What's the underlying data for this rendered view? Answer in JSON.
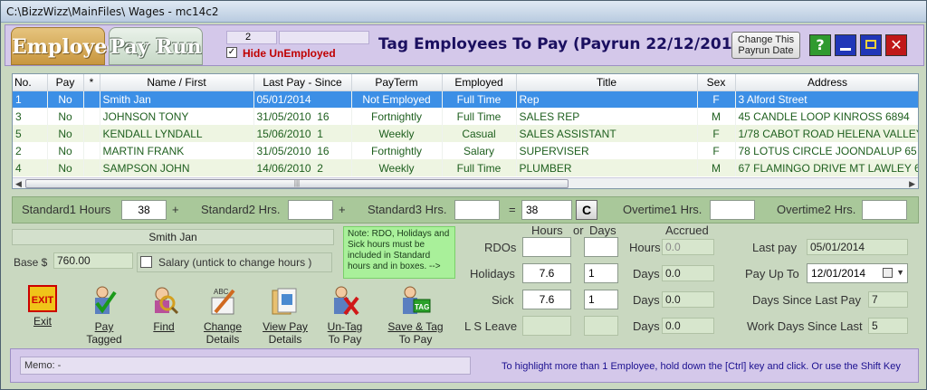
{
  "window": {
    "title": "C:\\BizzWizz\\MainFiles\\ Wages - mc14c2"
  },
  "header": {
    "tab_employee": "Employee",
    "tab_payrun": "Pay Run",
    "count": "2",
    "hide_unemployed_label": "Hide UnEmployed",
    "hide_unemployed_checked": true,
    "title": "Tag Employees To Pay (Payrun 22/12/2016)",
    "change_date_line1": "Change This",
    "change_date_line2": "Payrun Date",
    "help_glyph": "?"
  },
  "grid": {
    "columns": [
      "No.",
      "Pay",
      "*",
      "Name / First",
      "Last Pay - Since",
      "PayTerm",
      "Employed",
      "Title",
      "Sex",
      "Address"
    ],
    "rows": [
      {
        "no": "1",
        "pay": "No",
        "name": "Smith  Jan",
        "last_pay": "05/01/2014",
        "since": "",
        "payterm": "Not Employed",
        "employed": "Full Time",
        "title": "Rep",
        "sex": "F",
        "address": "3 Alford Street"
      },
      {
        "no": "3",
        "pay": "No",
        "name": "JOHNSON  TONY",
        "last_pay": "31/05/2010",
        "since": "16",
        "payterm": "Fortnightly",
        "employed": "Full Time",
        "title": "SALES REP",
        "sex": "M",
        "address": "45 CANDLE LOOP KINROSS  6894"
      },
      {
        "no": "5",
        "pay": "No",
        "name": "KENDALL  LYNDALL",
        "last_pay": "15/06/2010",
        "since": "1",
        "payterm": "Weekly",
        "employed": "Casual",
        "title": "SALES ASSISTANT",
        "sex": "F",
        "address": "1/78 CABOT ROAD HELENA VALLEY"
      },
      {
        "no": "2",
        "pay": "No",
        "name": "MARTIN  FRANK",
        "last_pay": "31/05/2010",
        "since": "16",
        "payterm": "Fortnightly",
        "employed": "Salary",
        "title": "SUPERVISER",
        "sex": "F",
        "address": "78 LOTUS CIRCLE JOONDALUP  65"
      },
      {
        "no": "4",
        "pay": "No",
        "name": "SAMPSON  JOHN",
        "last_pay": "14/06/2010",
        "since": "2",
        "payterm": "Weekly",
        "employed": "Full Time",
        "title": "PLUMBER",
        "sex": "M",
        "address": "67 FLAMINGO DRIVE MT LAWLEY  6"
      }
    ],
    "selected_index": 0
  },
  "hours_strip": {
    "std1_label": "Standard1 Hours",
    "std1_value": "38",
    "plus1": "+",
    "std2_label": "Standard2 Hrs.",
    "std2_value": "",
    "plus2": "+",
    "std3_label": "Standard3 Hrs.",
    "std3_value": "",
    "equals": "=",
    "total_value": "38",
    "c_button": "C",
    "ot1_label": "Overtime1 Hrs.",
    "ot1_value": "",
    "ot2_label": "Overtime2 Hrs.",
    "ot2_value": ""
  },
  "employee": {
    "name": "Smith  Jan",
    "base_label": "Base $",
    "base_value": "760.00",
    "salary_label": "Salary (untick to change hours )",
    "salary_checked": false
  },
  "note": "Note: RDO, Holidays and Sick hours must be included in Standard hours and in boxes. -->",
  "leave": {
    "hours_header": "Hours",
    "or_label": "or",
    "days_header": "Days",
    "accrued_header": "Accrued",
    "rdo_label": "RDOs",
    "rdo_hours": "",
    "rdo_days": "",
    "rdo_unit": "Hours",
    "rdo_accrued": "0.0",
    "hol_label": "Holidays",
    "hol_hours": "7.6",
    "hol_days": "1",
    "hol_unit": "Days",
    "hol_accrued": "0.0",
    "sick_label": "Sick",
    "sick_hours": "7.6",
    "sick_days": "1",
    "sick_unit": "Days",
    "sick_accrued": "0.0",
    "ls_label": "L S Leave",
    "ls_hours": "",
    "ls_days": "",
    "ls_unit": "Days",
    "ls_accrued": "0.0"
  },
  "pay_info": {
    "last_pay_label": "Last pay",
    "last_pay_value": "05/01/2014",
    "pay_up_to_label": "Pay Up To",
    "pay_up_to_value": "12/01/2014",
    "days_since_label": "Days Since Last Pay",
    "days_since_value": "7",
    "work_days_label": "Work Days Since Last",
    "work_days_value": "5"
  },
  "toolbar": {
    "exit_icon_text": "EXIT",
    "exit": "Exit",
    "pay_tagged_1": "Pay",
    "pay_tagged_2": "Tagged",
    "find": "Find",
    "change_details_1": "Change",
    "change_details_2": "Details",
    "change_icon_text": "ABC",
    "view_pay_1": "View Pay",
    "view_pay_2": "Details",
    "untag_1": "Un-Tag",
    "untag_2": "To Pay",
    "save_tag_1": "Save & Tag",
    "save_tag_2": "To Pay",
    "save_icon_text": "TAG"
  },
  "memo": {
    "value": "Memo: -",
    "tip": "To highlight more than 1 Employee, hold down the [Ctrl] key and click.  Or use the Shift Key"
  },
  "colors": {
    "accent_purple": "#d4c8ea",
    "select_blue": "#3c8fe6",
    "row_green": "#1e5f1e",
    "note_green": "#a9f09a",
    "hide_red": "#c00000"
  }
}
